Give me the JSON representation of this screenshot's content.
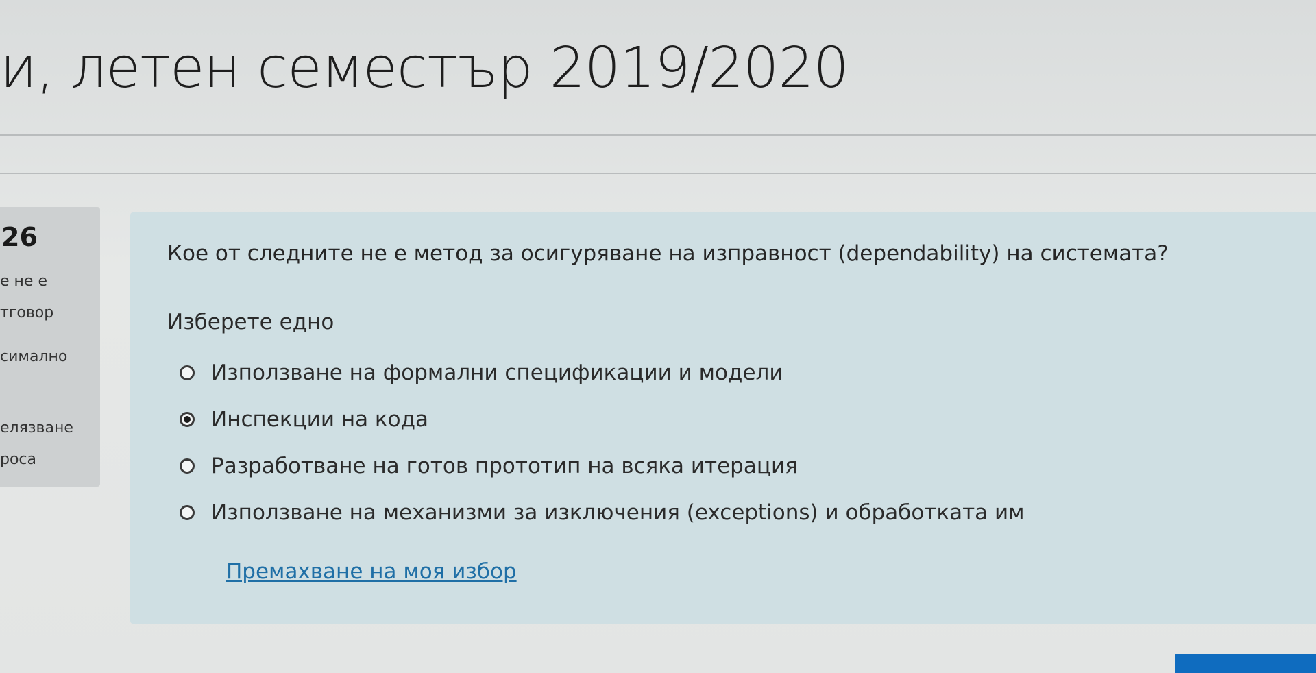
{
  "header": {
    "course_title": "и, летен семестър 2019/2020"
  },
  "question_info": {
    "number": "26",
    "lines": [
      "е не е",
      "тговор",
      "симално",
      "елязване",
      "роса"
    ]
  },
  "question": {
    "text": "Кое от следните не е метод за осигуряване на изправност (dependability) на системата?",
    "prompt": "Изберете едно",
    "answers": [
      {
        "label": "Използване на формални спецификации и модели",
        "checked": false
      },
      {
        "label": "Инспекции на кода",
        "checked": true
      },
      {
        "label": "Разработване на готов прототип на всяка итерация",
        "checked": false
      },
      {
        "label": "Използване на механизми за изключения (exceptions) и обработката им",
        "checked": false
      }
    ],
    "clear_choice": "Премахване на моя избор"
  },
  "colors": {
    "panel": "#cfdfe3",
    "link": "#1f6fa6",
    "primary_button": "#0f6cbf"
  }
}
